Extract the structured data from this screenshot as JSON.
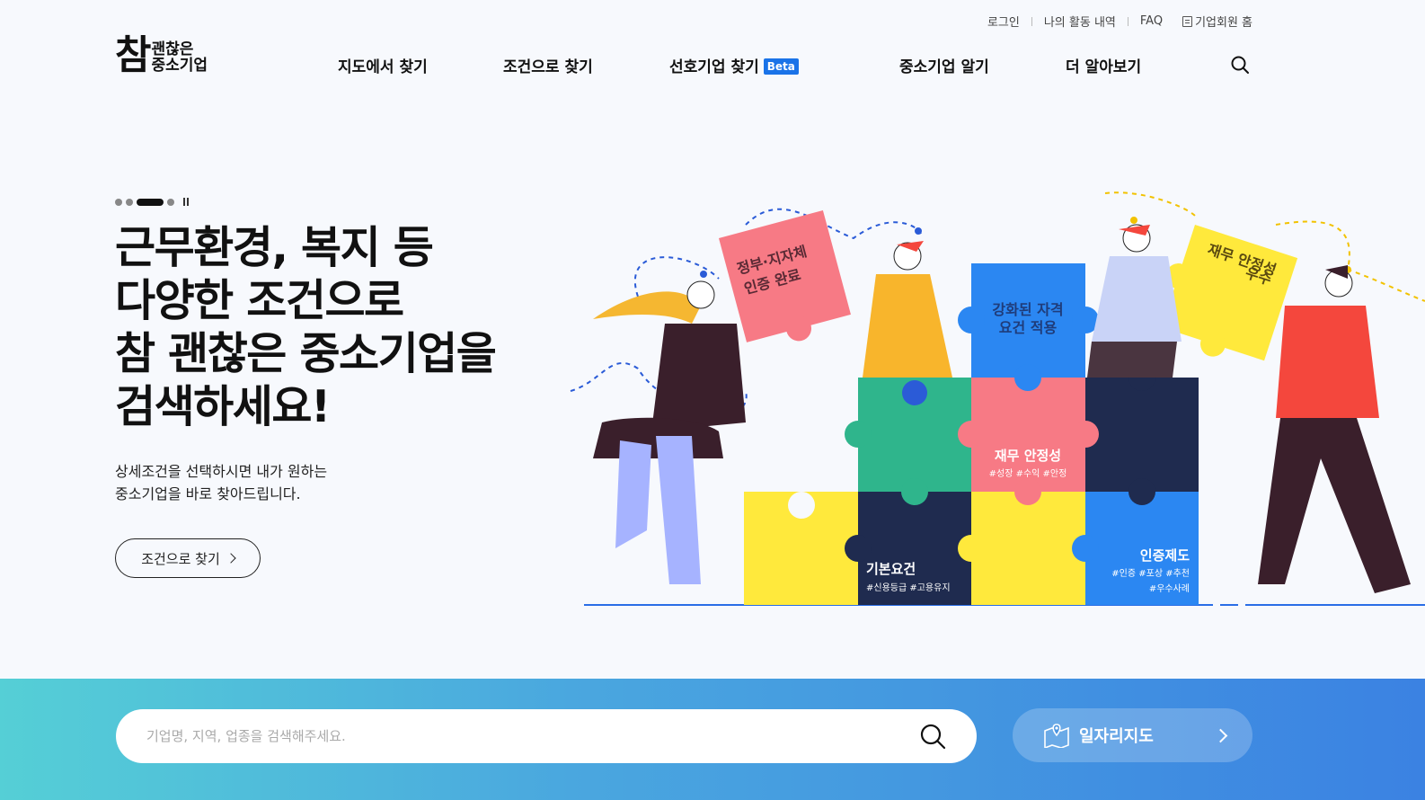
{
  "util_nav": {
    "login": "로그인",
    "my_activity": "나의 활동 내역",
    "faq": "FAQ",
    "corp_home": "기업회원 홈"
  },
  "logo": {
    "big": "참",
    "line1": "괜찮은",
    "line2": "중소기업"
  },
  "gnb": {
    "map_search": "지도에서 찾기",
    "condition_search": "조건으로 찾기",
    "preferred_search": "선호기업 찾기",
    "beta": "Beta",
    "know_sme": "중소기업 알기",
    "more": "더 알아보기"
  },
  "hero": {
    "title": "근무환경, 복지 등\n다양한 조건으로\n참 괜찮은 중소기업을\n검색하세요!",
    "subtitle": "상세조건을 선택하시면 내가 원하는\n중소기업을 바로 찾아드립니다.",
    "button": "조건으로 찾기",
    "slides_total": 4,
    "slide_active": 3
  },
  "puzzle": {
    "gov_cert_1": "정부·지자체",
    "gov_cert_2": "인증 완료",
    "qualified_1": "강화된 자격",
    "qualified_2": "요건 적용",
    "finance_top_1": "재무 안정성",
    "finance_top_2": "우수",
    "finance": "재무 안정성",
    "finance_tags": "#성장 #수익 #안정",
    "basic": "기본요건",
    "basic_tags": "#신용등급 #고용유지",
    "cert_system": "인증제도",
    "cert_tags_1": "#인증 #포상 #추천",
    "cert_tags_2": "#우수사례"
  },
  "search": {
    "placeholder": "기업명, 지역, 업종을 검색해주세요."
  },
  "jobmap": {
    "label": "일자리지도"
  },
  "colors": {
    "accent": "#1a73e8",
    "gradient_start": "#55cfd6",
    "gradient_end": "#3b82e2"
  }
}
